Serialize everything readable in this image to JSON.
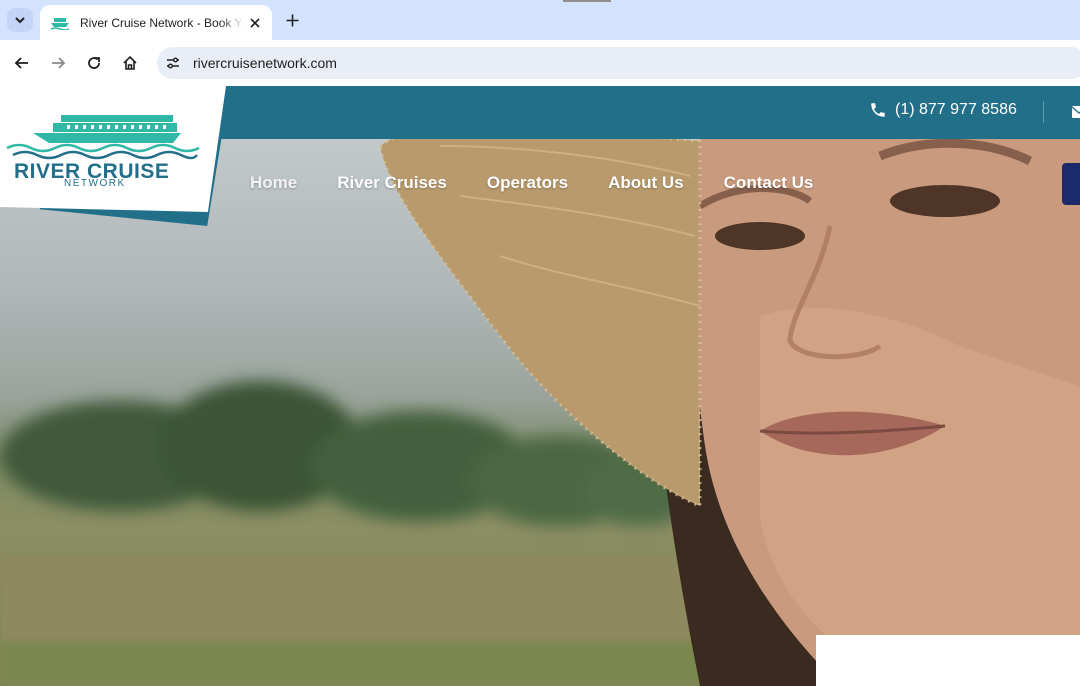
{
  "browser": {
    "tab_title": "River Cruise Network - Book Your River Cruise",
    "url": "rivercruisenetwork.com"
  },
  "site": {
    "phone": "(1) 877 977 8586",
    "logo": {
      "title": "RIVER CRUISE",
      "subtitle": "NETWORK"
    },
    "nav": [
      "Home",
      "River Cruises",
      "Operators",
      "About Us",
      "Contact Us"
    ]
  },
  "colors": {
    "brand_teal": "#226f8a",
    "logo_aqua": "#2fb8a6",
    "cta_navy": "#1b2a6b"
  },
  "icons": {
    "phone": "phone-icon",
    "mail": "mail-icon",
    "back": "arrow-left-icon",
    "forward": "arrow-right-icon",
    "reload": "reload-icon",
    "home": "home-icon"
  }
}
